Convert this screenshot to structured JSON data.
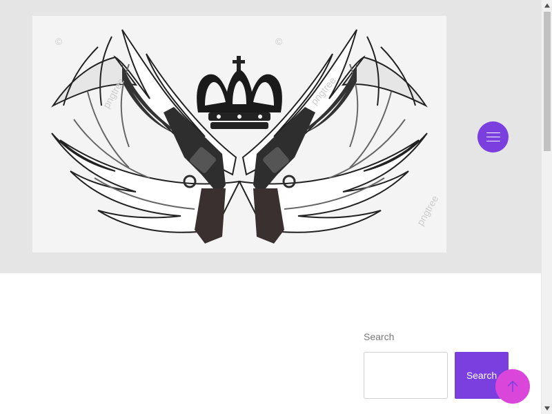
{
  "header": {
    "logo_watermark": "pngtree",
    "logo_copyright": "©",
    "menu_icon": "hamburger-icon",
    "accent_color": "#7b3fe0"
  },
  "search": {
    "label": "Search",
    "input_value": "",
    "button_label": "Search"
  },
  "scroll_top": {
    "icon": "arrow-up-icon",
    "color": "#d946d9"
  }
}
